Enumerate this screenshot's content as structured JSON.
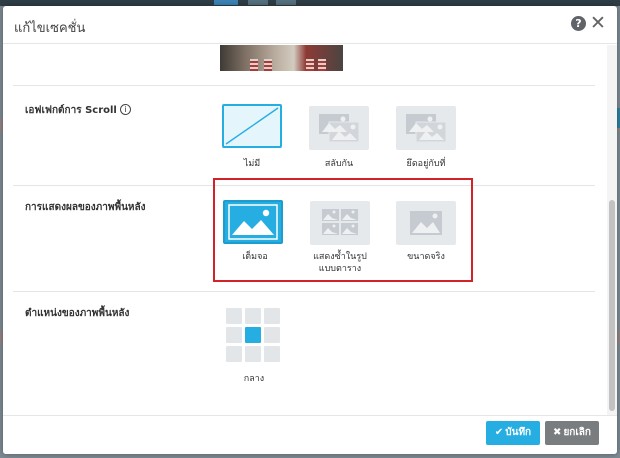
{
  "dialog": {
    "title": "แก้ไขเซคชั่น",
    "help_icon": "question-circle-icon",
    "close_icon": "close-x-icon"
  },
  "scroll_effect": {
    "label": "เอฟเฟกต์การ Scroll",
    "info_glyph": "i",
    "options": [
      {
        "label": "ไม่มี",
        "icon": "no-effect-icon",
        "selected": true
      },
      {
        "label": "สลับกัน",
        "icon": "parallax-images-icon",
        "selected": false
      },
      {
        "label": "ยึดอยู่กับที่",
        "icon": "fixed-images-icon",
        "selected": false
      }
    ]
  },
  "background_display": {
    "label": "การแสดงผลของภาพพื้นหลัง",
    "options": [
      {
        "label": "เต็มจอ",
        "icon": "full-screen-image-icon",
        "selected": true
      },
      {
        "label": "แสดงซ้ำในรูปแบบตาราง",
        "label_line1": "แสดงซ้ำในรูป",
        "label_line2": "แบบตาราง",
        "icon": "tiled-images-icon",
        "selected": false
      },
      {
        "label": "ขนาดจริง",
        "icon": "actual-size-image-icon",
        "selected": false
      }
    ]
  },
  "background_position": {
    "label": "ตำแหน่งของภาพพื้นหลัง",
    "selected_label": "กลาง",
    "selected_cell": 4
  },
  "footer": {
    "save_label": "บันทึก",
    "save_icon": "check-icon",
    "save_glyph": "✔",
    "cancel_label": "ยกเลิก",
    "cancel_icon": "x-icon",
    "cancel_glyph": "✖"
  },
  "colors": {
    "accent": "#26aee2",
    "highlight_box": "#d2232a",
    "cancel_button": "#7a7d80"
  }
}
